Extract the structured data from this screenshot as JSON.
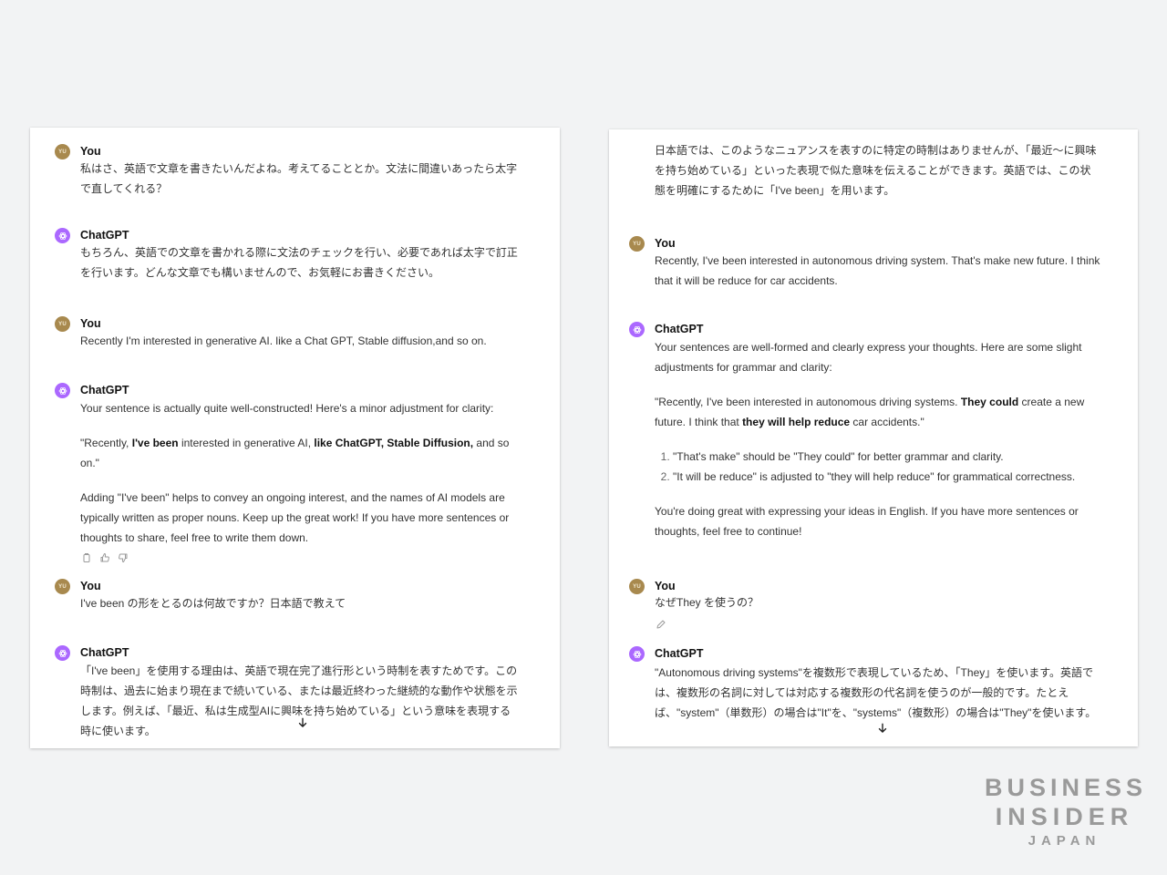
{
  "left_panel": {
    "messages": [
      {
        "author": "You",
        "avatar_text": "YU",
        "text": "私はさ、英語で文章を書きたいんだよね。考えてることとか。文法に間違いあったら太字で直してくれる？"
      },
      {
        "author": "ChatGPT",
        "text": "もちろん、英語での文章を書かれる際に文法のチェックを行い、必要であれば太字で訂正を行います。どんな文章でも構いませんので、お気軽にお書きください。"
      },
      {
        "author": "You",
        "avatar_text": "YU",
        "text": "Recently I'm interested in generative AI. like a Chat GPT, Stable diffusion,and so on."
      },
      {
        "author": "ChatGPT",
        "p1": "Your sentence is actually quite well-constructed! Here's a minor adjustment for clarity:",
        "quote": {
          "a": "\"Recently, ",
          "b": "I've been",
          "c": " interested in generative AI, ",
          "d": "like ChatGPT, Stable Diffusion,",
          "e": " and so on.\""
        },
        "p3": "Adding \"I've been\" helps to convey an ongoing interest, and the names of AI models are typically written as proper nouns. Keep up the great work! If you have more sentences or thoughts to share, feel free to write them down.",
        "actions": [
          "copy-icon",
          "thumbs-up-icon",
          "thumbs-down-icon"
        ]
      },
      {
        "author": "You",
        "avatar_text": "YU",
        "text": "I've been の形をとるのは何故ですか？日本語で教えて"
      },
      {
        "author": "ChatGPT",
        "text": "「I've been」を使用する理由は、英語で現在完了進行形という時制を表すためです。この時制は、過去に始まり現在まで続いている、または最近終わった継続的な動作や状態を示します。例えば、「最近、私は生成型AIに興味を持ち始めている」という意味を表現する時に使います。"
      }
    ]
  },
  "right_panel": {
    "messages": [
      {
        "text": "日本語では、このようなニュアンスを表すのに特定の時制はありませんが、「最近〜に興味を持ち始めている」といった表現で似た意味を伝えることができます。英語では、この状態を明確にするために「I've been」を用います。"
      },
      {
        "author": "You",
        "avatar_text": "YU",
        "text": "Recently, I've been interested in autonomous driving system. That's make new future. I think that it will be reduce for car accidents."
      },
      {
        "author": "ChatGPT",
        "p1": "Your sentences are well-formed and clearly express your thoughts. Here are some slight adjustments for grammar and clarity:",
        "quote": {
          "a": "\"Recently, I've been interested in autonomous driving systems. ",
          "b": "They could",
          "c": " create a new future. I think that ",
          "d": "they will help reduce",
          "e": " car accidents.\""
        },
        "list": [
          "\"That's make\" should be \"They could\" for better grammar and clarity.",
          "\"It will be reduce\" is adjusted to \"they will help reduce\" for grammatical correctness."
        ],
        "p4": "You're doing great with expressing your ideas in English. If you have more sentences or thoughts, feel free to continue!"
      },
      {
        "author": "You",
        "avatar_text": "YU",
        "text": "なぜThey を使うの？",
        "action": "edit-icon"
      },
      {
        "author": "ChatGPT",
        "text": "\"Autonomous driving systems\"を複数形で表現しているため、「They」を使います。英語では、複数形の名詞に対しては対応する複数形の代名詞を使うのが一般的です。たとえば、\"system\"（単数形）の場合は\"It\"を、\"systems\"（複数形）の場合は\"They\"を使います。"
      }
    ]
  },
  "logo": {
    "line1": "BUSINESS",
    "line2": "INSIDER",
    "line3": "JAPAN"
  },
  "colors": {
    "background": "#f2f3f4",
    "user_avatar": "#a8894e",
    "bot_avatar": "#ab68ff",
    "logo": "#9a9a9a"
  }
}
